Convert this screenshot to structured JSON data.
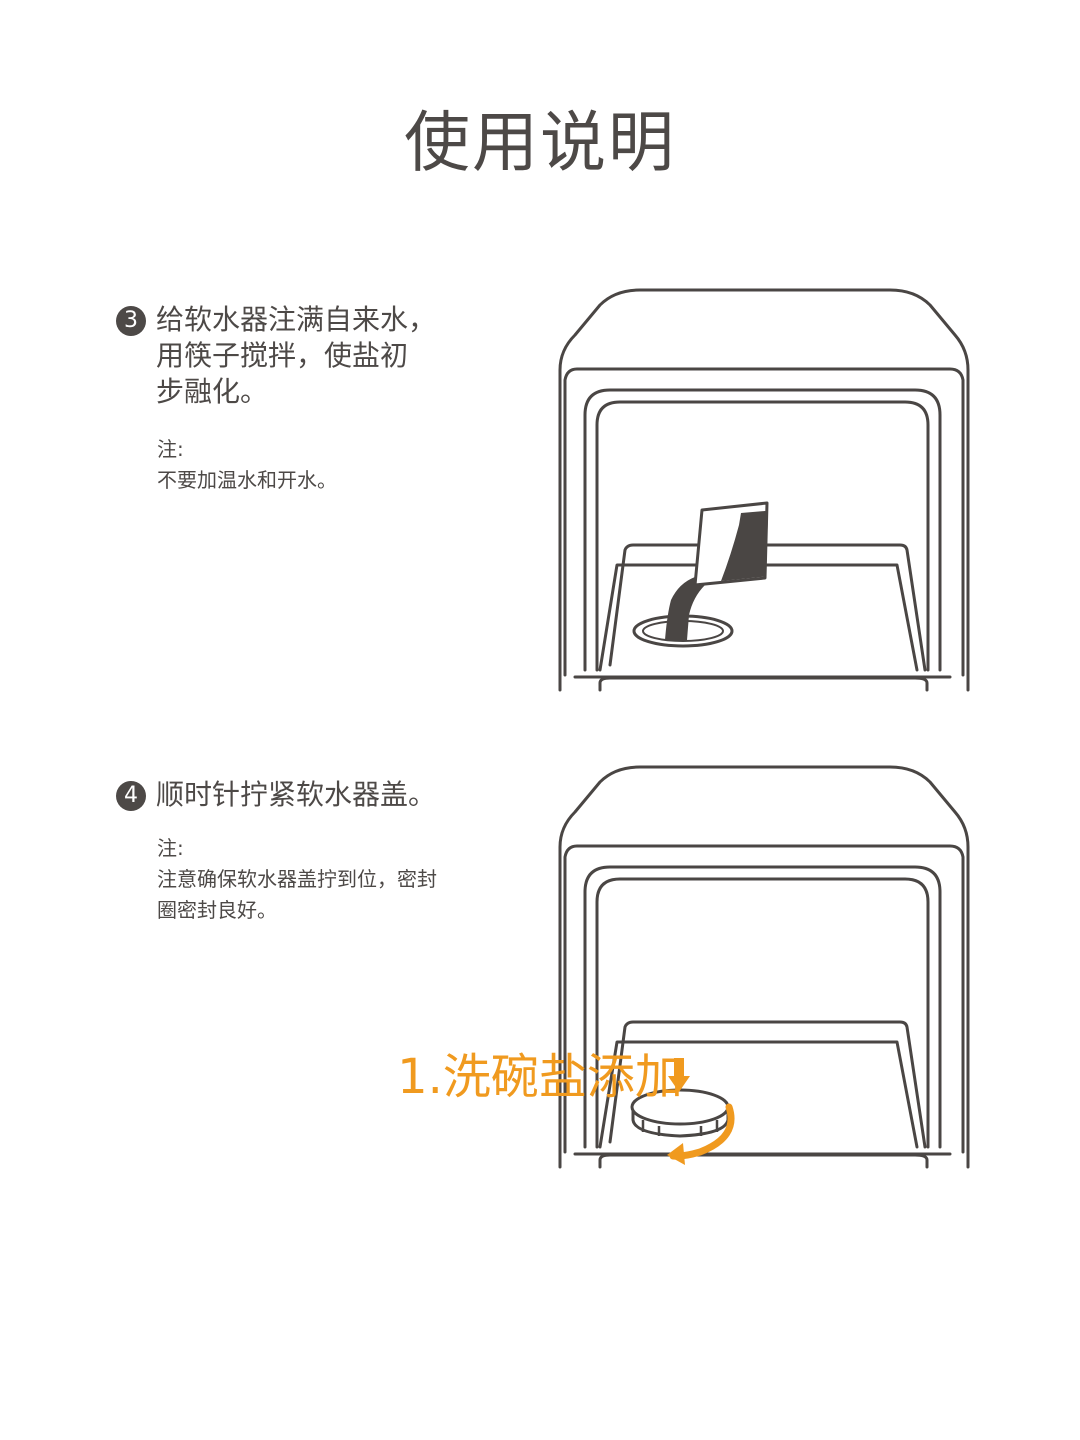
{
  "page": {
    "title": "使用说明"
  },
  "steps": [
    {
      "number": "3",
      "text": "给软水器注满自来水，\n用筷子搅拌，使盐初\n步融化。",
      "note": "注:\n不要加温水和开水。"
    },
    {
      "number": "4",
      "text": "顺时针拧紧软水器盖。",
      "note": "注:\n注意确保软水器盖拧到位，密封\n圈密封良好。"
    }
  ],
  "section": {
    "title": "1.洗碗盐添加"
  },
  "colors": {
    "text": "#4d4947",
    "accent": "#f09a1f",
    "line": "#4a4644"
  },
  "icons": {
    "salt_pack": "salt-pack-icon",
    "cap": "softener-cap-icon",
    "down_arrow": "down-arrow-icon",
    "rotate_arrow": "clockwise-arrow-icon"
  }
}
